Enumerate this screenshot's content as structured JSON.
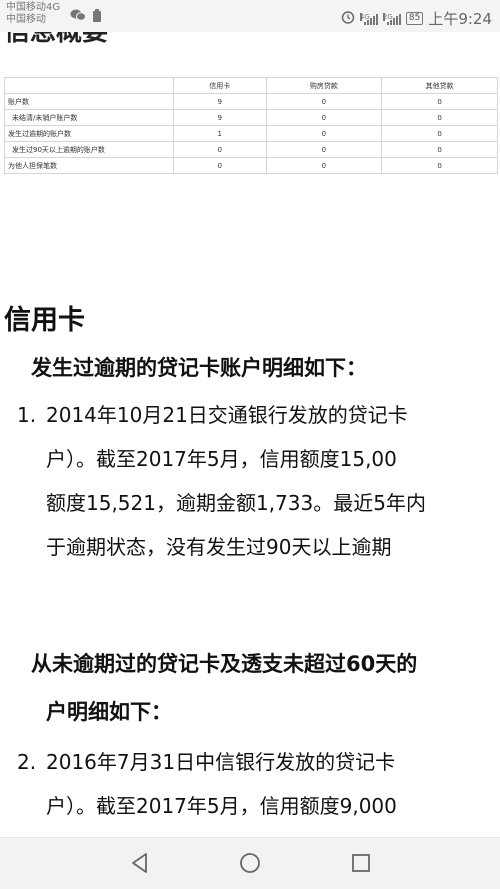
{
  "status": {
    "carrier1": "中国移动4G",
    "carrier2": "中国移动",
    "signal1_label": "4G",
    "signal2_label": "2G",
    "battery": "85",
    "time": "上午9:24"
  },
  "page": {
    "cut_title": "信息概要",
    "summary_table": {
      "headers": [
        "",
        "信用卡",
        "购房贷款",
        "其他贷款"
      ],
      "rows": [
        {
          "label": "账户数",
          "v": [
            "9",
            "0",
            "0"
          ]
        },
        {
          "label": "未结清/未销户账户数",
          "v": [
            "9",
            "0",
            "0"
          ]
        },
        {
          "label": "发生过逾期的账户数",
          "v": [
            "1",
            "0",
            "0"
          ]
        },
        {
          "label": "发生过90天以上逾期的账户数",
          "v": [
            "0",
            "0",
            "0"
          ]
        },
        {
          "label": "为他人担保笔数",
          "v": [
            "0",
            "0",
            "0"
          ]
        }
      ]
    },
    "section_title": "信用卡",
    "sub1": "发生过逾期的贷记卡账户明细如下：",
    "item1": {
      "num": "1.",
      "lines": [
        "2014年10月21日交通银行发放的贷记卡",
        "户）。截至2017年5月，信用额度15,00",
        "额度15,521，逾期金额1,733。最近5年内",
        "于逾期状态，没有发生过90天以上逾期"
      ]
    },
    "sub2_line1": "从未逾期过的贷记卡及透支未超过60天的",
    "sub2_line2": "户明细如下：",
    "item2": {
      "num": "2.",
      "lines": [
        "2016年7月31日中信银行发放的贷记卡",
        "户）。截至2017年5月，信用额度9,000"
      ]
    }
  }
}
